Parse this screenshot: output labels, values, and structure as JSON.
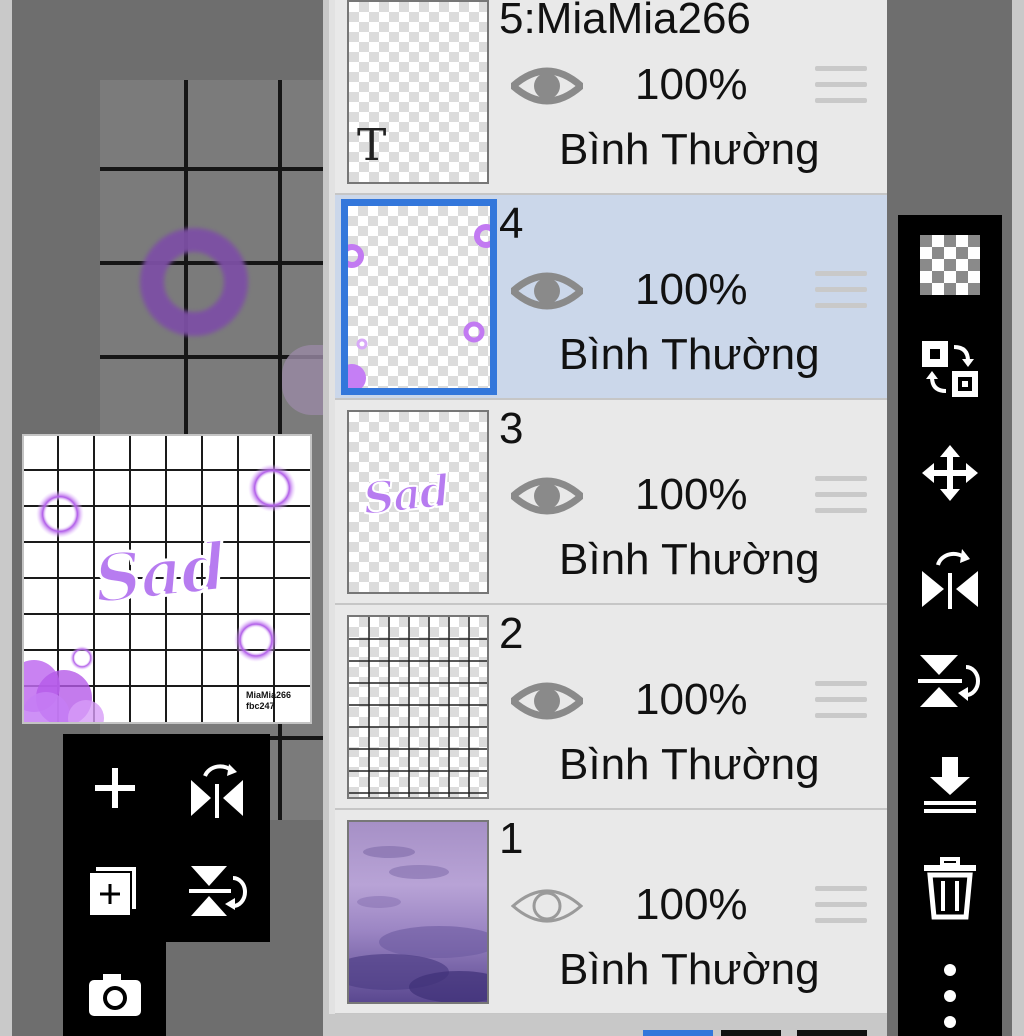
{
  "layers": [
    {
      "name": "5:MiaMia266",
      "opacity": "100%",
      "blend": "Bình Thường",
      "visible": true,
      "selected": false,
      "thumb_text": "T"
    },
    {
      "name": "4",
      "opacity": "100%",
      "blend": "Bình Thường",
      "visible": true,
      "selected": true
    },
    {
      "name": "3",
      "opacity": "100%",
      "blend": "Bình Thường",
      "visible": true,
      "selected": false,
      "thumb_text": "Sad"
    },
    {
      "name": "2",
      "opacity": "100%",
      "blend": "Bình Thường",
      "visible": true,
      "selected": false
    },
    {
      "name": "1",
      "opacity": "100%",
      "blend": "Bình Thường",
      "visible": false,
      "selected": false
    }
  ],
  "preview": {
    "text": "Sad",
    "watermark_line1": "MiaMia266",
    "watermark_line2": "fbc247"
  },
  "left_tools": [
    "add-layer",
    "flip-horizontal",
    "add-layer-copy",
    "flip-vertical",
    "camera"
  ],
  "right_tools": [
    "transparency",
    "swap-layers",
    "move",
    "flip-horizontal",
    "flip-vertical",
    "merge-down",
    "delete",
    "more"
  ],
  "colors": {
    "selected_row": "#cbd7ea",
    "selected_border": "#3377db",
    "accent_purple": "#b56ee8"
  }
}
